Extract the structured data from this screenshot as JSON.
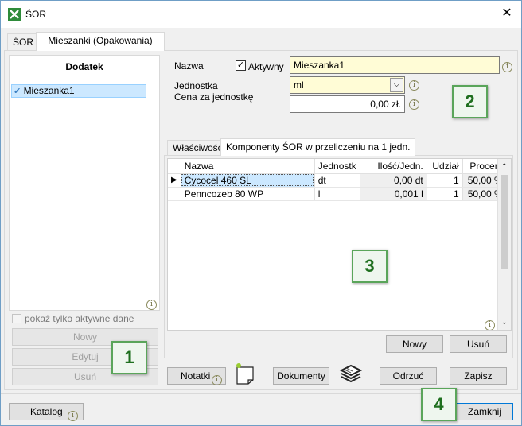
{
  "window": {
    "title": "ŚOR",
    "close_glyph": "✕"
  },
  "tabs": {
    "sor": "ŚOR",
    "mieszanki": "Mieszanki (Opakowania)"
  },
  "left": {
    "header": "Dodatek",
    "list": [
      {
        "label": "Mieszanka1",
        "checked": true
      }
    ],
    "only_active_label": "pokaż tylko aktywne dane",
    "buttons": {
      "new": "Nowy",
      "edit": "Edytuj",
      "delete": "Usuń"
    }
  },
  "form": {
    "name_label": "Nazwa",
    "active_label": "Aktywny",
    "active_checked": true,
    "name_value": "Mieszanka1",
    "unit_label": "Jednostka",
    "unit_value": "ml",
    "price_label": "Cena za jednostkę",
    "price_value": "0,00 zł."
  },
  "subtabs": {
    "props": "Właściwości",
    "components": "Komponenty ŚOR w przeliczeniu na 1 jedn."
  },
  "grid": {
    "columns": [
      "Nazwa",
      "Jednostk",
      "Ilość/Jedn.",
      "Udział",
      "Procent"
    ],
    "rows": [
      {
        "name": "Cycocel 460 SL",
        "unit": "dt",
        "qty": "0,00 dt",
        "share": "1",
        "percent": "50,00 %"
      },
      {
        "name": "Penncozeb 80 WP",
        "unit": "l",
        "qty": "0,001 l",
        "share": "1",
        "percent": "50,00 %"
      }
    ],
    "buttons": {
      "new": "Nowy",
      "delete": "Usuń"
    }
  },
  "bottom": {
    "notes": "Notatki",
    "documents": "Dokumenty",
    "reject": "Odrzuć",
    "save": "Zapisz",
    "catalog": "Katalog",
    "close": "Zamknij"
  },
  "badges": [
    "1",
    "2",
    "3",
    "4"
  ],
  "colors": {
    "accent": "#5aa55a",
    "selection": "#cce8ff",
    "required_bg": "#fffcd6"
  },
  "icons": [
    "app-x-icon",
    "info-icon",
    "checkmark-icon",
    "dropdown-chevron-icon",
    "note-icon",
    "documents-stack-icon",
    "row-indicator-icon"
  ]
}
